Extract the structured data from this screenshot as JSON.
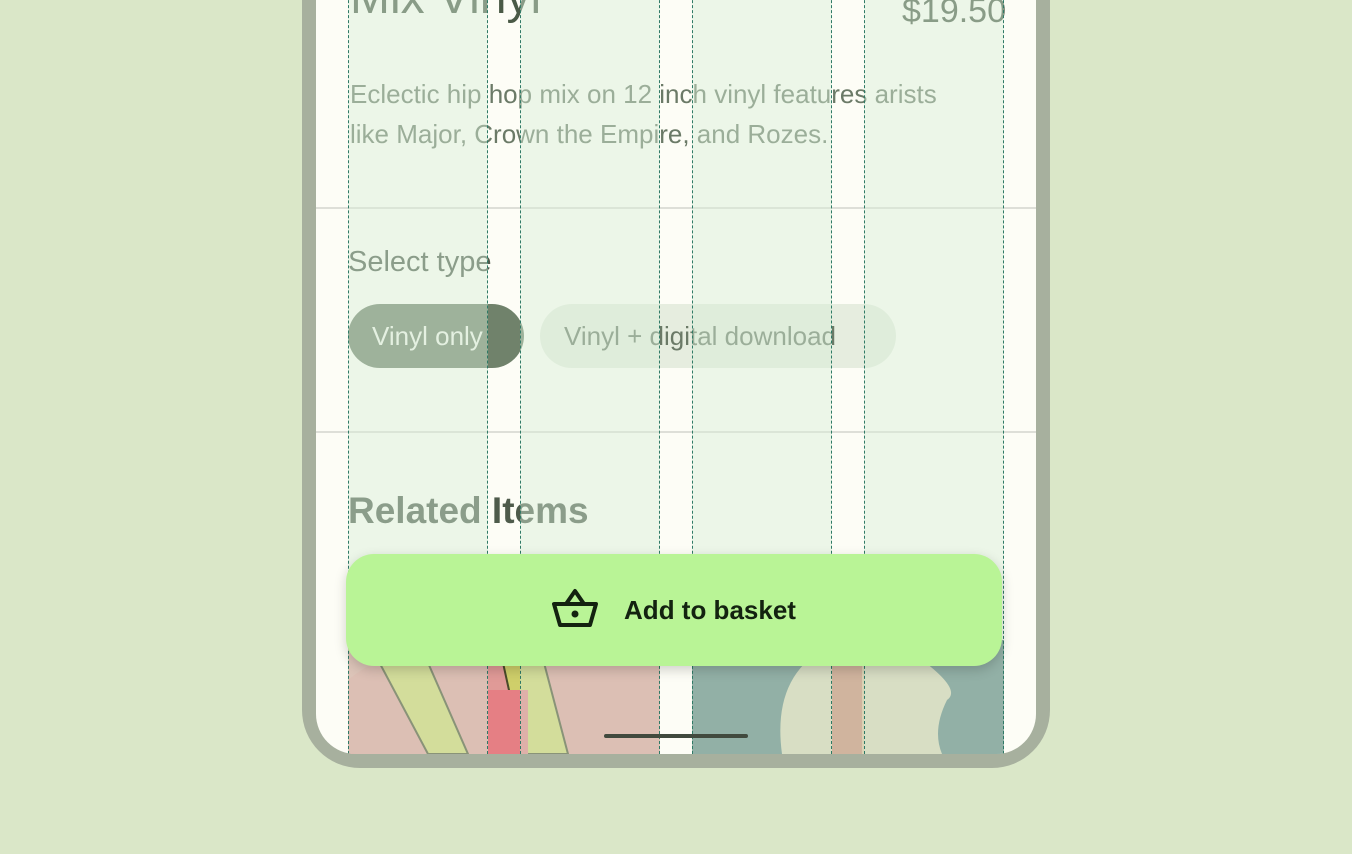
{
  "product": {
    "title": "Mix Vinyl",
    "price": "$19.50",
    "description": "Eclectic hip hop mix on 12 inch vinyl features arists like Major, Crown the Empire, and Rozes."
  },
  "type_selector": {
    "label": "Select type",
    "options": [
      {
        "label": "Vinyl only",
        "selected": true
      },
      {
        "label": "Vinyl + digital download",
        "selected": false
      }
    ]
  },
  "related": {
    "heading": "Related Items"
  },
  "cta": {
    "label": "Add to basket",
    "icon": "basket-icon",
    "color": "#b9f496"
  },
  "colors": {
    "background": "#dae7c8",
    "frame": "#a7b09e",
    "chip_selected": "#70826b",
    "chip_unselected": "#e6eddf"
  }
}
